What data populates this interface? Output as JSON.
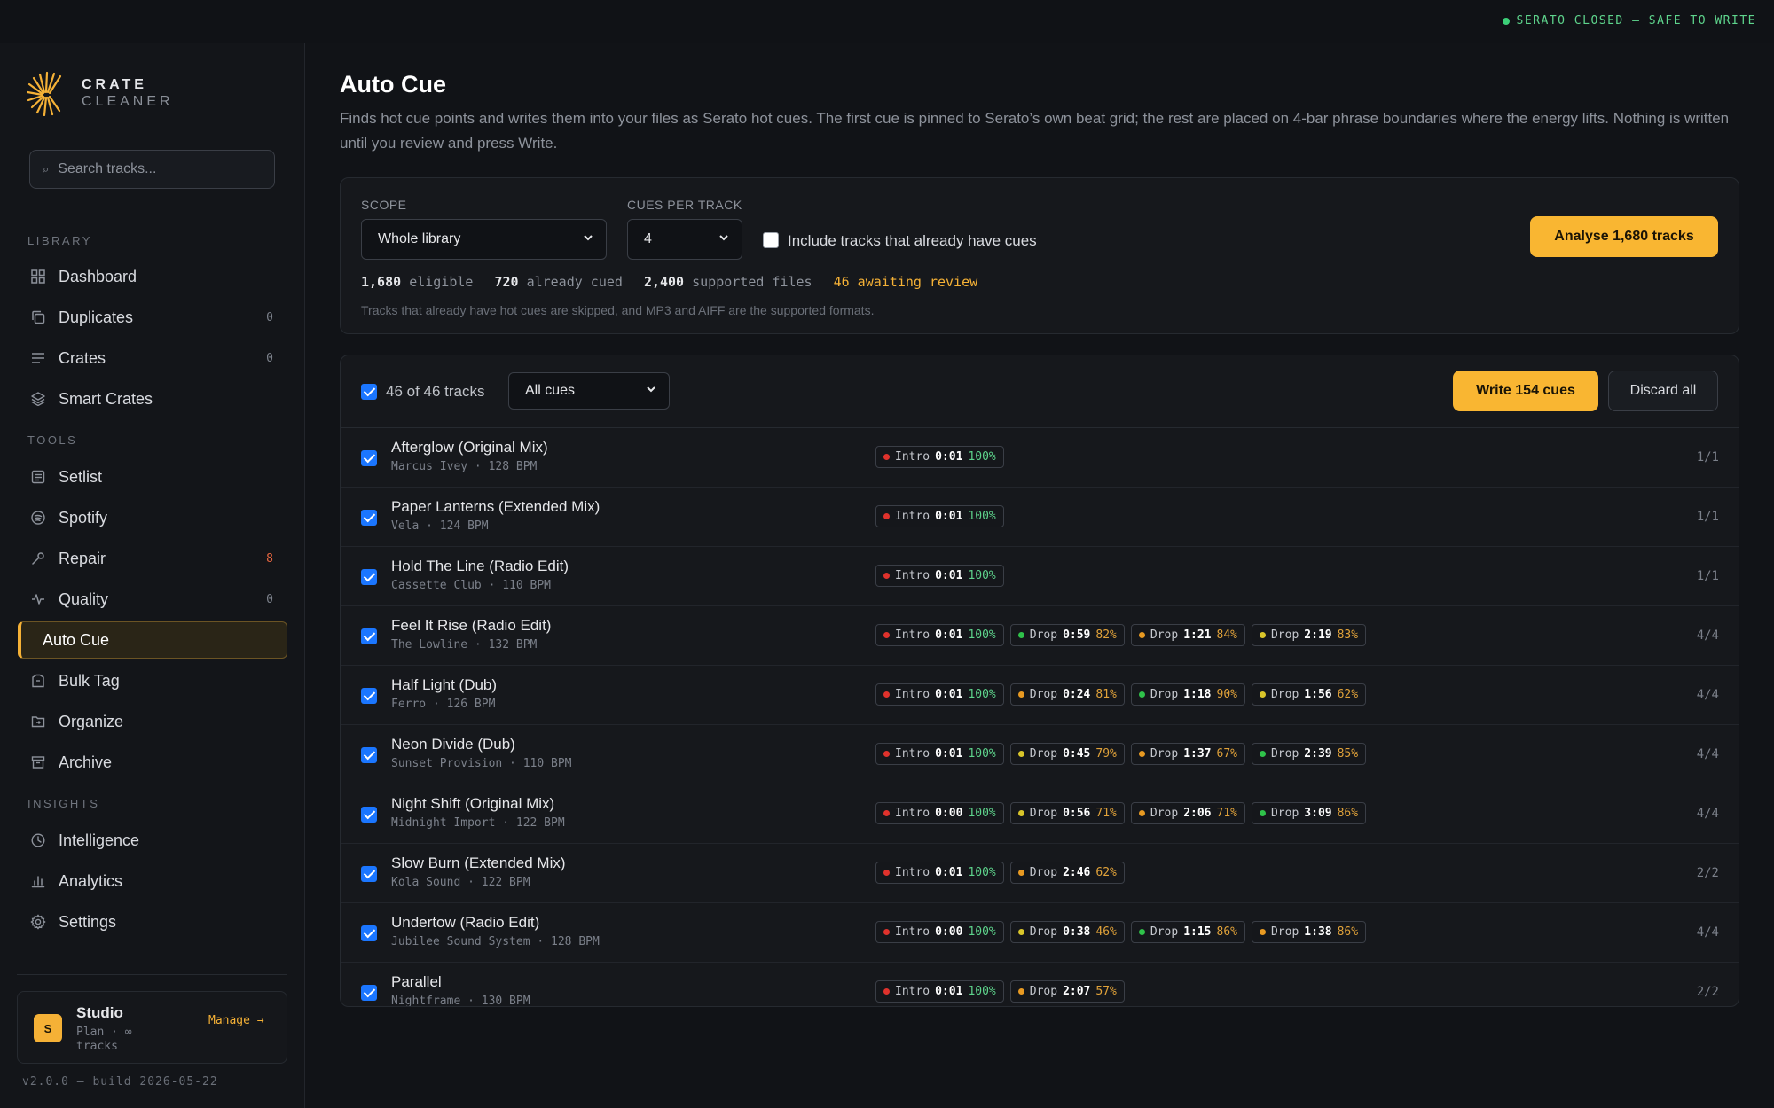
{
  "status": {
    "text": "SERATO CLOSED — SAFE TO WRITE",
    "color": "#3ccf78"
  },
  "brand": {
    "line1": "CRATE",
    "line2": "CLEANER",
    "accent": "#f5b136"
  },
  "search": {
    "placeholder": "Search tracks..."
  },
  "sidebar": {
    "sections": [
      "LIBRARY",
      "TOOLS",
      "INSIGHTS"
    ],
    "library": [
      {
        "label": "Dashboard",
        "icon": "grid-icon",
        "badge": ""
      },
      {
        "label": "Duplicates",
        "icon": "copy-icon",
        "badge": "0"
      },
      {
        "label": "Crates",
        "icon": "list-icon",
        "badge": "0"
      },
      {
        "label": "Smart Crates",
        "icon": "layers-icon",
        "badge": ""
      }
    ],
    "tools": [
      {
        "label": "Setlist",
        "icon": "setlist-icon",
        "badge": ""
      },
      {
        "label": "Spotify",
        "icon": "spotify-icon",
        "badge": ""
      },
      {
        "label": "Repair",
        "icon": "wrench-icon",
        "badge": "8"
      },
      {
        "label": "Quality",
        "icon": "pulse-icon",
        "badge": "0"
      },
      {
        "label": "Auto Cue",
        "icon": "",
        "badge": ""
      },
      {
        "label": "Bulk Tag",
        "icon": "tag-icon",
        "badge": ""
      },
      {
        "label": "Organize",
        "icon": "folder-icon",
        "badge": ""
      },
      {
        "label": "Archive",
        "icon": "archive-icon",
        "badge": ""
      }
    ],
    "insights": [
      {
        "label": "Intelligence",
        "icon": "clock-icon",
        "badge": ""
      },
      {
        "label": "Analytics",
        "icon": "bar-chart-icon",
        "badge": ""
      },
      {
        "label": "Settings",
        "icon": "gear-icon",
        "badge": ""
      }
    ],
    "plan": {
      "avatar": "S",
      "name": "Studio",
      "sub": "Plan · ∞ tracks",
      "manage": "Manage →"
    },
    "version": "v2.0.0 — build 2026-05-22"
  },
  "page": {
    "title": "Auto Cue",
    "description": "Finds hot cue points and writes them into your files as Serato hot cues. The first cue is pinned to Serato’s own beat grid; the rest are placed on 4-bar phrase boundaries where the energy lifts. Nothing is written until you review and press Write."
  },
  "config": {
    "scope_label": "SCOPE",
    "scope_value": "Whole library",
    "cues_label": "CUES PER TRACK",
    "cues_value": "4",
    "include_label": "Include tracks that already have cues",
    "include_checked": false,
    "analyse_label": "Analyse 1,680 tracks",
    "stats": {
      "eligible_num": "1,680",
      "eligible_text": "eligible",
      "cued_num": "720",
      "cued_text": "already cued",
      "supported_num": "2,400",
      "supported_text": "supported files",
      "awaiting": "46 awaiting review"
    },
    "note": "Tracks that already have hot cues are skipped, and MP3 and AIFF are the supported formats."
  },
  "review": {
    "count_label": "46 of 46 tracks",
    "filter_value": "All cues",
    "write_label": "Write 154 cues",
    "discard_label": "Discard all",
    "cue_colors": {
      "red": "#e0322c",
      "green": "#2fc24a",
      "orange": "#e89a22",
      "yellow": "#d9c52a"
    },
    "tracks": [
      {
        "title": "Afterglow (Original Mix)",
        "sub": "Marcus Ivey · 128 BPM",
        "ratio": "1/1",
        "cues": [
          {
            "name": "Intro",
            "time": "0:01",
            "pct": "100%",
            "color": "#e0322c"
          }
        ]
      },
      {
        "title": "Paper Lanterns (Extended Mix)",
        "sub": "Vela · 124 BPM",
        "ratio": "1/1",
        "cues": [
          {
            "name": "Intro",
            "time": "0:01",
            "pct": "100%",
            "color": "#e0322c"
          }
        ]
      },
      {
        "title": "Hold The Line (Radio Edit)",
        "sub": "Cassette Club · 110 BPM",
        "ratio": "1/1",
        "cues": [
          {
            "name": "Intro",
            "time": "0:01",
            "pct": "100%",
            "color": "#e0322c"
          }
        ]
      },
      {
        "title": "Feel It Rise (Radio Edit)",
        "sub": "The Lowline · 132 BPM",
        "ratio": "4/4",
        "cues": [
          {
            "name": "Intro",
            "time": "0:01",
            "pct": "100%",
            "color": "#e0322c"
          },
          {
            "name": "Drop",
            "time": "0:59",
            "pct": "82%",
            "color": "#2fc24a"
          },
          {
            "name": "Drop",
            "time": "1:21",
            "pct": "84%",
            "color": "#e89a22"
          },
          {
            "name": "Drop",
            "time": "2:19",
            "pct": "83%",
            "color": "#d9c52a"
          }
        ]
      },
      {
        "title": "Half Light (Dub)",
        "sub": "Ferro · 126 BPM",
        "ratio": "4/4",
        "cues": [
          {
            "name": "Intro",
            "time": "0:01",
            "pct": "100%",
            "color": "#e0322c"
          },
          {
            "name": "Drop",
            "time": "0:24",
            "pct": "81%",
            "color": "#e89a22"
          },
          {
            "name": "Drop",
            "time": "1:18",
            "pct": "90%",
            "color": "#2fc24a"
          },
          {
            "name": "Drop",
            "time": "1:56",
            "pct": "62%",
            "color": "#d9c52a"
          }
        ]
      },
      {
        "title": "Neon Divide (Dub)",
        "sub": "Sunset Provision · 110 BPM",
        "ratio": "4/4",
        "cues": [
          {
            "name": "Intro",
            "time": "0:01",
            "pct": "100%",
            "color": "#e0322c"
          },
          {
            "name": "Drop",
            "time": "0:45",
            "pct": "79%",
            "color": "#d9c52a"
          },
          {
            "name": "Drop",
            "time": "1:37",
            "pct": "67%",
            "color": "#e89a22"
          },
          {
            "name": "Drop",
            "time": "2:39",
            "pct": "85%",
            "color": "#2fc24a"
          }
        ]
      },
      {
        "title": "Night Shift (Original Mix)",
        "sub": "Midnight Import · 122 BPM",
        "ratio": "4/4",
        "cues": [
          {
            "name": "Intro",
            "time": "0:00",
            "pct": "100%",
            "color": "#e0322c"
          },
          {
            "name": "Drop",
            "time": "0:56",
            "pct": "71%",
            "color": "#d9c52a"
          },
          {
            "name": "Drop",
            "time": "2:06",
            "pct": "71%",
            "color": "#e89a22"
          },
          {
            "name": "Drop",
            "time": "3:09",
            "pct": "86%",
            "color": "#2fc24a"
          }
        ]
      },
      {
        "title": "Slow Burn (Extended Mix)",
        "sub": "Kola Sound · 122 BPM",
        "ratio": "2/2",
        "cues": [
          {
            "name": "Intro",
            "time": "0:01",
            "pct": "100%",
            "color": "#e0322c"
          },
          {
            "name": "Drop",
            "time": "2:46",
            "pct": "62%",
            "color": "#e89a22"
          }
        ]
      },
      {
        "title": "Undertow (Radio Edit)",
        "sub": "Jubilee Sound System · 128 BPM",
        "ratio": "4/4",
        "cues": [
          {
            "name": "Intro",
            "time": "0:00",
            "pct": "100%",
            "color": "#e0322c"
          },
          {
            "name": "Drop",
            "time": "0:38",
            "pct": "46%",
            "color": "#d9c52a"
          },
          {
            "name": "Drop",
            "time": "1:15",
            "pct": "86%",
            "color": "#2fc24a"
          },
          {
            "name": "Drop",
            "time": "1:38",
            "pct": "86%",
            "color": "#e89a22"
          }
        ]
      },
      {
        "title": "Parallel",
        "sub": "Nightframe · 130 BPM",
        "ratio": "2/2",
        "cues": [
          {
            "name": "Intro",
            "time": "0:01",
            "pct": "100%",
            "color": "#e0322c"
          },
          {
            "name": "Drop",
            "time": "2:07",
            "pct": "57%",
            "color": "#e89a22"
          }
        ]
      }
    ]
  }
}
